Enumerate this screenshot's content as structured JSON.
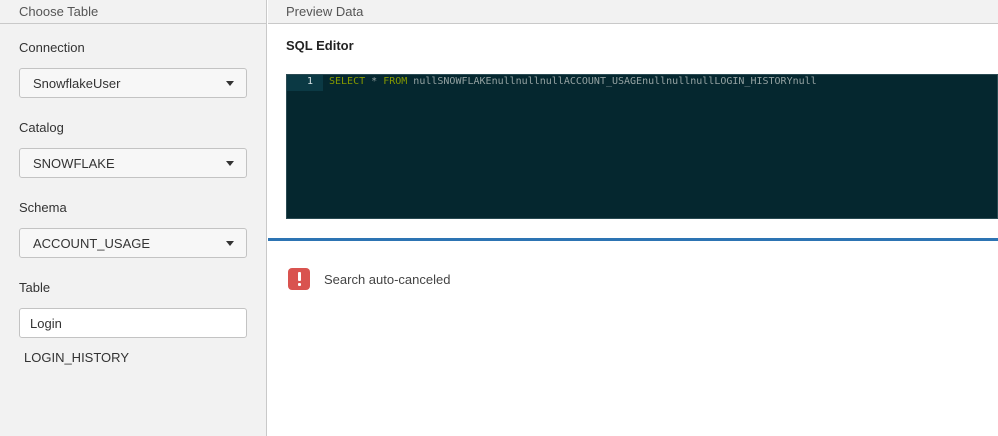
{
  "left_panel": {
    "header": "Choose Table",
    "connection": {
      "label": "Connection",
      "value": "SnowflakeUser"
    },
    "catalog": {
      "label": "Catalog",
      "value": "SNOWFLAKE"
    },
    "schema": {
      "label": "Schema",
      "value": "ACCOUNT_USAGE"
    },
    "table": {
      "label": "Table",
      "input_value": "Login",
      "results": [
        "LOGIN_HISTORY"
      ]
    }
  },
  "right_panel": {
    "header": "Preview Data",
    "sql_editor": {
      "title": "SQL Editor",
      "line_number": "1",
      "keyword_select": "SELECT",
      "star": " * ",
      "keyword_from": "FROM",
      "rest": " nullSNOWFLAKEnullnullnullACCOUNT_USAGEnullnullnullLOGIN_HISTORYnull"
    },
    "error": {
      "message": "Search auto-canceled"
    }
  },
  "colors": {
    "editor_bg": "#05272f",
    "keyword": "#859900",
    "divider": "#2d74b3",
    "error": "#d9534f"
  },
  "icons": [
    "chevron-down-icon",
    "error-icon"
  ]
}
